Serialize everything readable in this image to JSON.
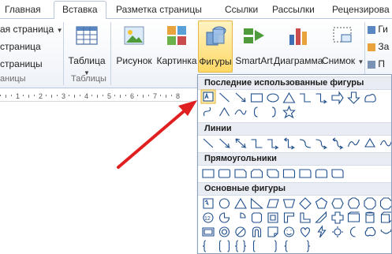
{
  "tabs": [
    {
      "label": "Главная",
      "active": false
    },
    {
      "label": "Вставка",
      "active": true
    },
    {
      "label": "Разметка страницы",
      "active": false
    },
    {
      "label": "Ссылки",
      "active": false
    },
    {
      "label": "Рассылки",
      "active": false
    },
    {
      "label": "Рецензирова",
      "active": false
    }
  ],
  "ribbon": {
    "pages_group": {
      "items": [
        "ая страница",
        "страница",
        " страницы"
      ],
      "group_label": "аницы"
    },
    "tables_group": {
      "button_label": "Таблица",
      "group_label": "Таблицы"
    },
    "illustrations": {
      "picture_label": "Рисунок",
      "clipart_label": "Картинка",
      "shapes_label": "Фигуры",
      "smartart_label": "SmartArt",
      "chart_label": "Диаграмма",
      "screenshot_label": "Снимок"
    },
    "right_partial": [
      "Ги",
      "За",
      "П"
    ]
  },
  "ruler": {
    "marks": [
      "1",
      "2",
      "3",
      "4",
      "5",
      "6",
      "7",
      "8"
    ]
  },
  "shapes_menu": {
    "sections": [
      {
        "title": "Последние использованные фигуры"
      },
      {
        "title": "Линии"
      },
      {
        "title": "Прямоугольники"
      },
      {
        "title": "Основные фигуры"
      }
    ],
    "recent_selected": "text-box",
    "badge_12": "12"
  },
  "colors": {
    "accent": "#e6b640",
    "arrow": "#e02020",
    "shape_stroke": "#1f4e8c",
    "section_bg": "#e9edf3"
  }
}
